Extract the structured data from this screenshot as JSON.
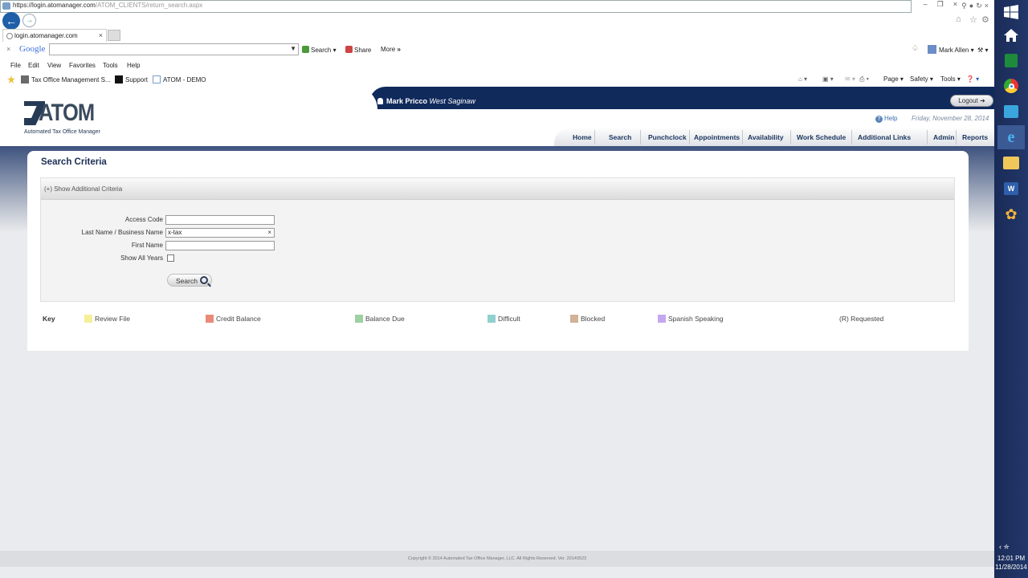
{
  "browser": {
    "url_main": "https://login.atomanager.com",
    "url_rest": "/ATOM_CLIENTS/return_search.aspx",
    "tab_title": "login.atomanager.com",
    "tab_close": "×",
    "window_controls": [
      "–",
      "❐",
      "×"
    ],
    "google": {
      "logo": "Google",
      "search_label": "Search",
      "share_label": "Share",
      "more_label": "More",
      "user_name": "Mark Allen"
    },
    "menu": [
      "File",
      "Edit",
      "View",
      "Favorites",
      "Tools",
      "Help"
    ],
    "favorites": [
      "Tax Office Management S...",
      "Support",
      "ATOM - DEMO"
    ],
    "commands": [
      "Page",
      "Safety",
      "Tools"
    ]
  },
  "header": {
    "logo_word": "ATOM",
    "logo_tagline": "Automated Tax Office Manager",
    "user_name": "Mark Pricco",
    "user_office": "West Saginaw",
    "logout_label": "Logout",
    "help_label": "Help",
    "date": "Friday, November 28, 2014",
    "nav": [
      "Home",
      "Search",
      "Punchclock",
      "Appointments",
      "Availability",
      "Work Schedule",
      "Additional Links",
      "Admin",
      "Reports"
    ]
  },
  "search_panel": {
    "title": "Search Criteria",
    "toggle_label": "(+) Show Additional Criteria",
    "fields": {
      "access_code_label": "Access Code",
      "access_code_value": "",
      "last_name_label": "Last Name / Business Name",
      "last_name_value": "x-tax",
      "first_name_label": "First Name",
      "first_name_value": "",
      "show_all_years_label": "Show All Years",
      "show_all_years_checked": false
    },
    "search_button": "Search"
  },
  "key": {
    "title": "Key",
    "items": [
      {
        "label": "Review File",
        "color": "#f5ef9a"
      },
      {
        "label": "Credit Balance",
        "color": "#e88a78"
      },
      {
        "label": "Balance Due",
        "color": "#9fd0a2"
      },
      {
        "label": "Difficult",
        "color": "#92cfcf"
      },
      {
        "label": "Blocked",
        "color": "#d2b396"
      },
      {
        "label": "Spanish Speaking",
        "color": "#c3a8ee"
      }
    ],
    "requested": "(R) Requested"
  },
  "footer": {
    "copyright": "Copyright © 2014 Automated Tax Office Manager, LLC. All Rights Reserved. Ver. 20140523"
  },
  "taskbar": {
    "time": "12:01 PM",
    "date": "11/28/2014"
  }
}
